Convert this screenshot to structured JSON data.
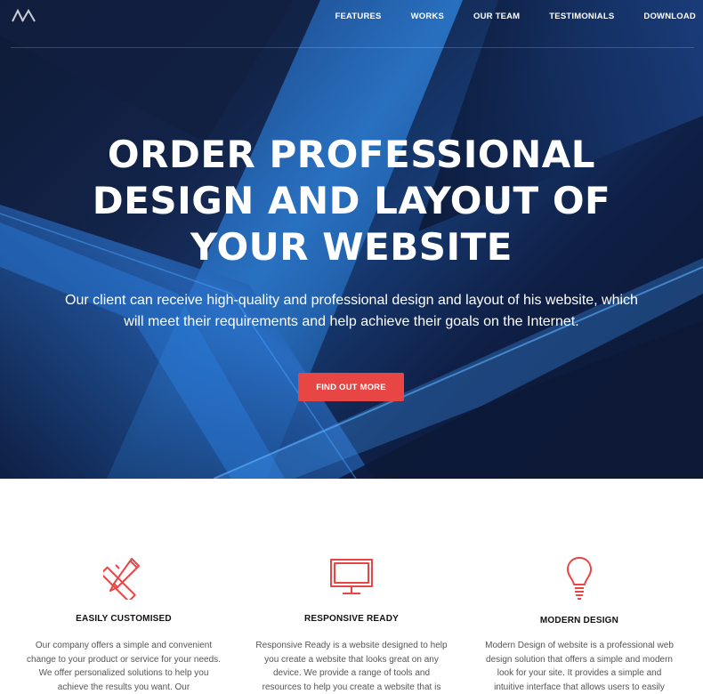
{
  "nav": {
    "logo_icon": "m-logo-icon",
    "items": [
      {
        "label": "FEATURES"
      },
      {
        "label": "WORKS"
      },
      {
        "label": "OUR TEAM"
      },
      {
        "label": "TESTIMONIALS"
      },
      {
        "label": "DOWNLOAD"
      }
    ]
  },
  "hero": {
    "title_line1": "ORDER PROFESSIONAL",
    "title_line2": "DESIGN AND LAYOUT OF",
    "title_line3": "YOUR WEBSITE",
    "subtitle": "Our client can receive high-quality and professional design and layout of his website, which will meet their requirements and help achieve their goals on the Internet.",
    "cta_label": "FIND OUT MORE"
  },
  "features": [
    {
      "icon": "pencil-ruler-icon",
      "title": "EASILY CUSTOMISED",
      "text": "Our company offers a simple and convenient change to your product or service for your needs. We offer personalized solutions to help you achieve the results you want. Our"
    },
    {
      "icon": "monitor-icon",
      "title": "RESPONSIVE READY",
      "text": "Responsive Ready is a website designed to help you create a website that looks great on any device. We provide a range of tools and resources to help you create a website that is"
    },
    {
      "icon": "lightbulb-icon",
      "title": "MODERN DESIGN",
      "text": "Modern Design of website is a professional web design solution that offers a simple and modern look for your site. It provides a simple and intuitive interface that allows users to easily"
    }
  ],
  "colors": {
    "accent": "#e84545",
    "hero_dark": "#0e1a36",
    "hero_blue": "#1e6fd0"
  }
}
